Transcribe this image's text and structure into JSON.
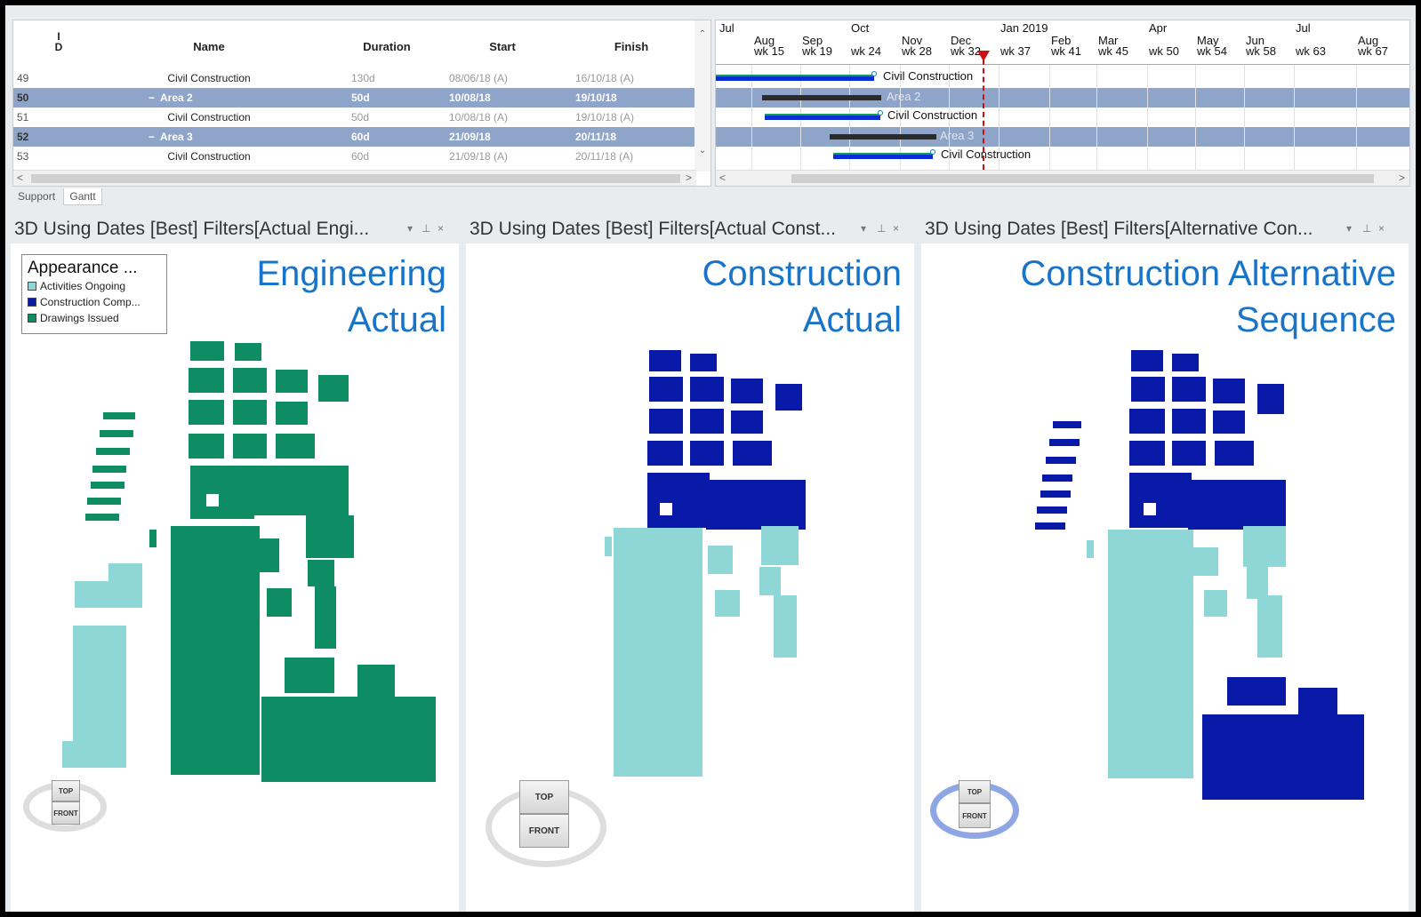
{
  "table": {
    "headers": {
      "id": "I\nD",
      "name": "Name",
      "duration": "Duration",
      "start": "Start",
      "finish": "Finish"
    },
    "rows": [
      {
        "id": "49",
        "name": "Civil Construction",
        "duration": "130d",
        "start": "08/06/18 (A)",
        "finish": "16/10/18 (A)",
        "summary": false
      },
      {
        "id": "50",
        "name": "Area 2",
        "duration": "50d",
        "start": "10/08/18",
        "finish": "19/10/18",
        "summary": true
      },
      {
        "id": "51",
        "name": "Civil Construction",
        "duration": "50d",
        "start": "10/08/18 (A)",
        "finish": "19/10/18 (A)",
        "summary": false
      },
      {
        "id": "52",
        "name": "Area 3",
        "duration": "60d",
        "start": "21/09/18",
        "finish": "20/11/18",
        "summary": true
      },
      {
        "id": "53",
        "name": "Civil Construction",
        "duration": "60d",
        "start": "21/09/18 (A)",
        "finish": "20/11/18 (A)",
        "summary": false
      }
    ]
  },
  "gantt": {
    "months_top": [
      "Jul",
      "Oct",
      "Jan 2019",
      "Apr",
      "Jul"
    ],
    "months_mid": [
      "Aug",
      "Sep",
      "Nov",
      "Dec",
      "Feb",
      "Mar",
      "May",
      "Jun",
      "Aug"
    ],
    "weeks": [
      "wk 15",
      "wk 19",
      "wk 24",
      "wk 28",
      "wk 32",
      "wk 37",
      "wk 41",
      "wk 45",
      "wk 50",
      "wk 54",
      "wk 58",
      "wk 63",
      "wk 67"
    ],
    "bar_labels": [
      "Civil Construction",
      "Area 2",
      "Civil Construction",
      "Area 3",
      "Civil Construction"
    ]
  },
  "tabs": [
    "Support",
    "Gantt"
  ],
  "panels": [
    {
      "title": "3D Using Dates [Best] Filters[Actual Engi...",
      "label_line1": "Engineering",
      "label_line2": "Actual"
    },
    {
      "title": "3D Using Dates [Best] Filters[Actual Const...",
      "label_line1": "Construction",
      "label_line2": "Actual"
    },
    {
      "title": "3D Using Dates [Best] Filters[Alternative Con...",
      "label_line1": "Construction Alternative",
      "label_line2": "Sequence"
    }
  ],
  "panel_controls": {
    "dropdown": "▾",
    "pin": "⊥",
    "close": "×"
  },
  "legend": {
    "title": "Appearance ...",
    "items": [
      {
        "label": "Activities Ongoing",
        "color": "#8fd6d6"
      },
      {
        "label": "Construction Comp...",
        "color": "#0a1aa8"
      },
      {
        "label": "Drawings Issued",
        "color": "#0e8c63"
      }
    ]
  },
  "viewcube": {
    "top": "TOP",
    "front": "FRONT"
  },
  "colors": {
    "ongoing": "#8fd6d6",
    "complete": "#0a1aa8",
    "drawings": "#0e8c63",
    "summary_row": "#8ea4c8",
    "label_blue": "#1874c8"
  }
}
